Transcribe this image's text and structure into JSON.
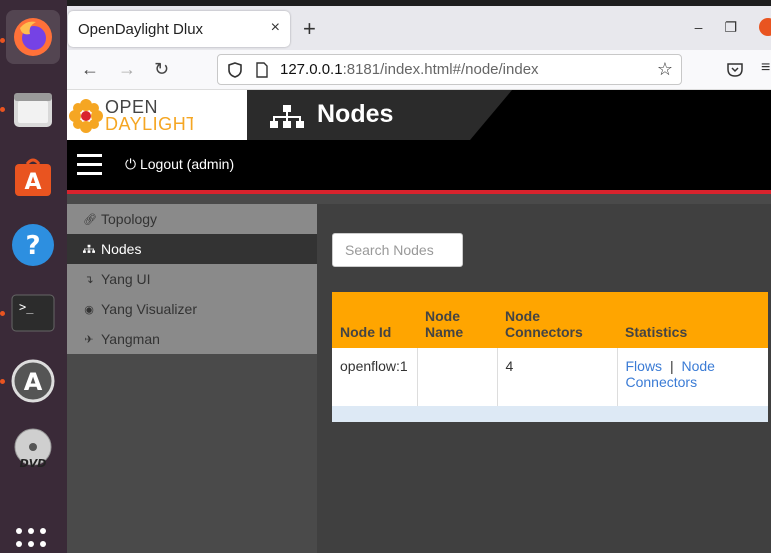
{
  "browser": {
    "tab_title": "OpenDaylight Dlux",
    "tab_close": "×",
    "new_tab": "+",
    "url_host": "127.0.0.1",
    "url_rest": ":8181/index.html#/node/index",
    "window_minimize": "–",
    "window_restore": "❐"
  },
  "logo": {
    "line1": "OPEN",
    "line2": "DAYLIGHT"
  },
  "header": {
    "title": "Nodes",
    "logout": "Logout (admin)"
  },
  "sidebar": {
    "items": [
      {
        "label": "Topology",
        "icon": "link-icon"
      },
      {
        "label": "Nodes",
        "icon": "sitemap-icon"
      },
      {
        "label": "Yang UI",
        "icon": "level-down-icon"
      },
      {
        "label": "Yang Visualizer",
        "icon": "eye-icon"
      },
      {
        "label": "Yangman",
        "icon": "plane-icon"
      }
    ]
  },
  "main": {
    "search_placeholder": "Search Nodes",
    "columns": [
      "Node Id",
      "Node Name",
      "Node Connectors",
      "Statistics"
    ],
    "rows": [
      {
        "node_id": "openflow:1",
        "node_name": "",
        "connectors": "4",
        "stats_flows": "Flows",
        "stats_sep": "|",
        "stats_connectors": "Node Connectors"
      }
    ]
  },
  "colors": {
    "accent_orange": "#ffa500",
    "red_line": "#d9232d",
    "link": "#3a7bd5"
  }
}
